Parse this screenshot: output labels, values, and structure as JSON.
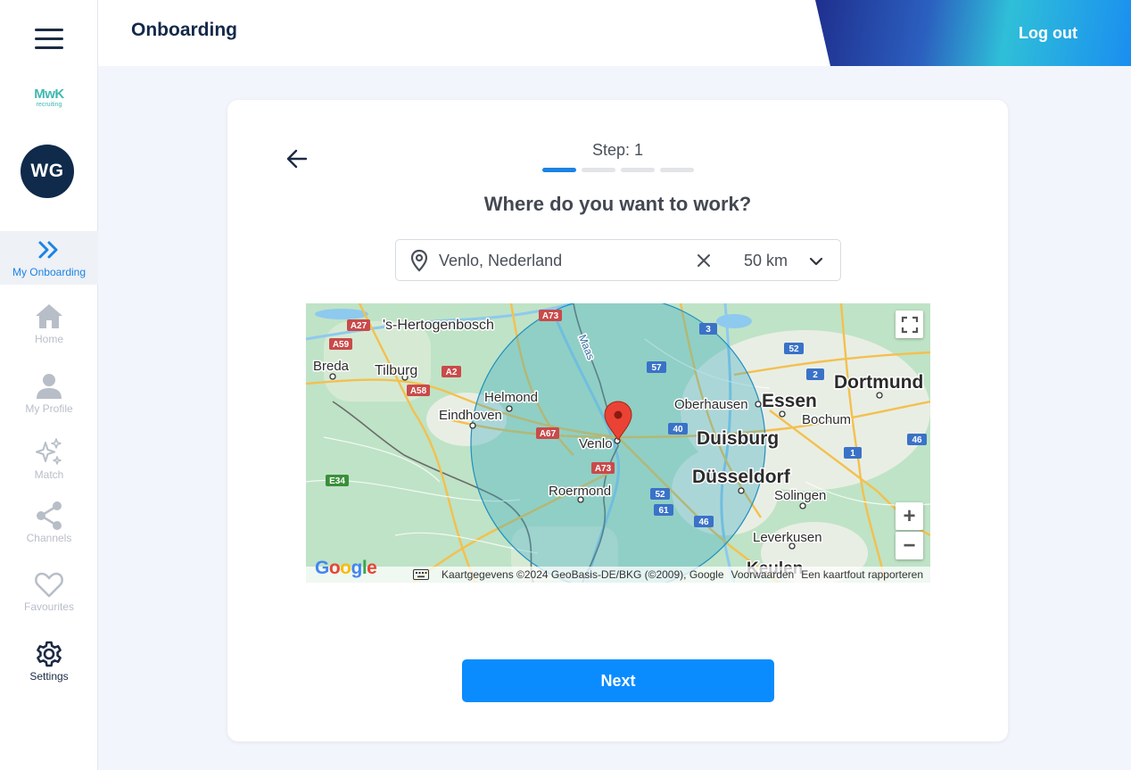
{
  "sidebar": {
    "logo_text": "MwK",
    "logo_sub": "recruiting",
    "avatar_initials": "WG",
    "items": [
      {
        "label": "My Onboarding",
        "icon": "double-chevron-right-icon"
      },
      {
        "label": "Home",
        "icon": "home-icon"
      },
      {
        "label": "My Profile",
        "icon": "person-icon"
      },
      {
        "label": "Match",
        "icon": "sparkles-icon"
      },
      {
        "label": "Channels",
        "icon": "share-icon"
      },
      {
        "label": "Favourites",
        "icon": "heart-icon"
      },
      {
        "label": "Settings",
        "icon": "gear-icon"
      }
    ]
  },
  "header": {
    "title": "Onboarding",
    "logout_label": "Log out"
  },
  "onboarding": {
    "step_label": "Step: 1",
    "step_current": 1,
    "step_total": 4,
    "question": "Where do you want to work?",
    "location_value": "Venlo, Nederland",
    "radius_value": "50 km",
    "next_label": "Next"
  },
  "map": {
    "labels": {
      "hertogenbosch": "'s-Hertogenbosch",
      "breda": "Breda",
      "tilburg": "Tilburg",
      "helmond": "Helmond",
      "eindhoven": "Eindhoven",
      "venlo": "Venlo",
      "roermond": "Roermond",
      "oberhausen": "Oberhausen",
      "essen": "Essen",
      "dortmund": "Dortmund",
      "bochum": "Bochum",
      "duisburg": "Duisburg",
      "dusseldorf": "Düsseldorf",
      "solingen": "Solingen",
      "leverkusen": "Leverkusen",
      "keulen": "Keulen",
      "maas": "Maas"
    },
    "road_shields": [
      "A27",
      "A59",
      "A2",
      "A58",
      "A73",
      "A67",
      "A73",
      "E34",
      "3",
      "57",
      "52",
      "2",
      "40",
      "1",
      "46",
      "52",
      "61",
      "46"
    ],
    "google_logo": "Google",
    "attribution": {
      "data": "Kaartgegevens ©2024 GeoBasis-DE/BKG (©2009), Google",
      "terms": "Voorwaarden",
      "report": "Een kaartfout rapporteren"
    },
    "zoom_in": "+",
    "zoom_out": "−"
  },
  "colors": {
    "accent": "#0a8cff",
    "active_nav": "#1b83e4",
    "navy": "#14294a"
  }
}
